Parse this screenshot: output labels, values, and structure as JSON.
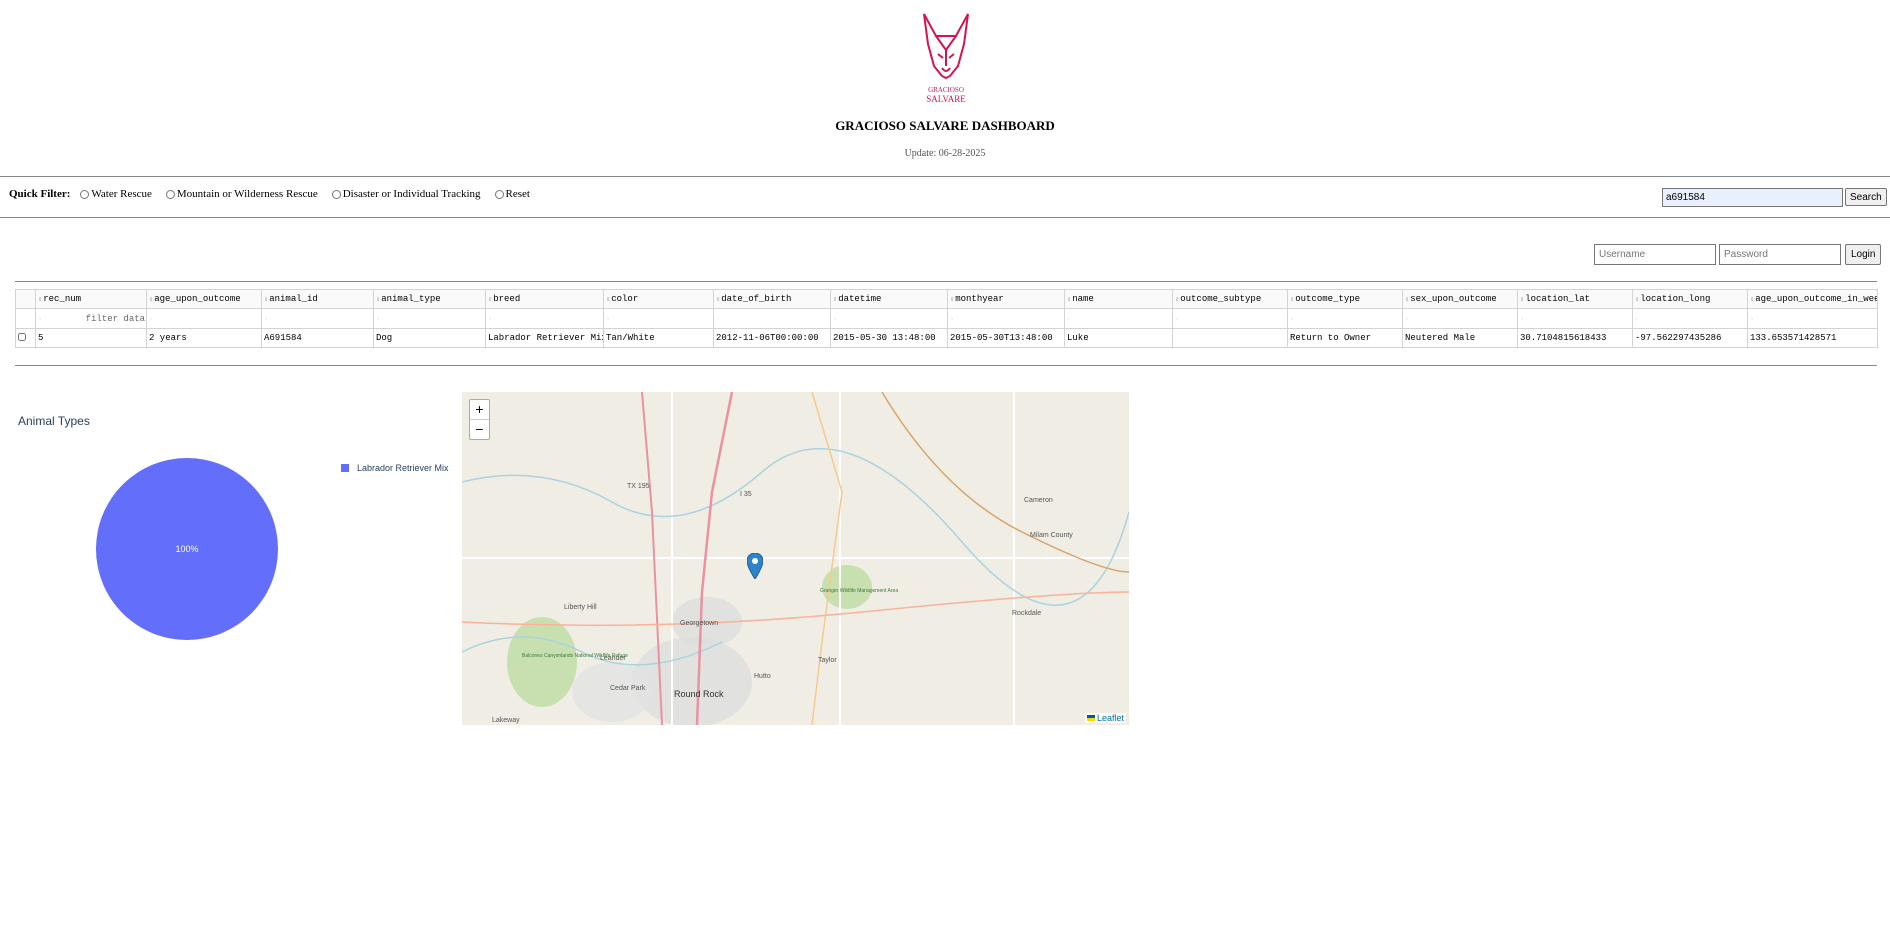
{
  "header": {
    "logo_text_top": "GRACIOSO",
    "logo_text_bottom": "SALVARE",
    "title": "GRACIOSO SALVARE DASHBOARD",
    "update": "Update: 06-28-2025"
  },
  "quick_filter": {
    "label": "Quick Filter:",
    "options": [
      "Water Rescue",
      "Mountain or Wilderness Rescue",
      "Disaster or Individual Tracking",
      "Reset"
    ]
  },
  "search": {
    "value": "a691584",
    "button": "Search"
  },
  "login": {
    "username_placeholder": "Username",
    "password_placeholder": "Password",
    "button": "Login"
  },
  "table": {
    "columns": [
      "rec_num",
      "age_upon_outcome",
      "animal_id",
      "animal_type",
      "breed",
      "color",
      "date_of_birth",
      "datetime",
      "monthyear",
      "name",
      "outcome_subtype",
      "outcome_type",
      "sex_upon_outcome",
      "location_lat",
      "location_long",
      "age_upon_outcome_in_weeks"
    ],
    "filter_placeholder": "filter data...",
    "rows": [
      [
        "5",
        "2 years",
        "A691584",
        "Dog",
        "Labrador Retriever Mix",
        "Tan/White",
        "2012-11-06T00:00:00",
        "2015-05-30 13:48:00",
        "2015-05-30T13:48:00",
        "Luke",
        "",
        "Return to Owner",
        "Neutered Male",
        "30.7104815618433",
        "-97.562297435286",
        "133.653571428571"
      ]
    ]
  },
  "chart_data": {
    "type": "pie",
    "title": "Animal Types",
    "labels": [
      "Labrador Retriever Mix"
    ],
    "values": [
      100
    ],
    "slice_label": "100%",
    "colors": [
      "#636efa"
    ],
    "legend_position": "right"
  },
  "map": {
    "zoom_in": "+",
    "zoom_out": "−",
    "attribution": "Leaflet",
    "place_labels": [
      "TX 195",
      "I 35",
      "Cameron",
      "Milam County",
      "Liberty Hill",
      "Georgetown",
      "Granger Wildlife Management Area",
      "Rockdale",
      "Leander",
      "Balcones Canyonlands National Wildlife Refuge",
      "Cedar Park",
      "Round Rock",
      "Hutto",
      "Taylor",
      "Lakeway"
    ]
  }
}
